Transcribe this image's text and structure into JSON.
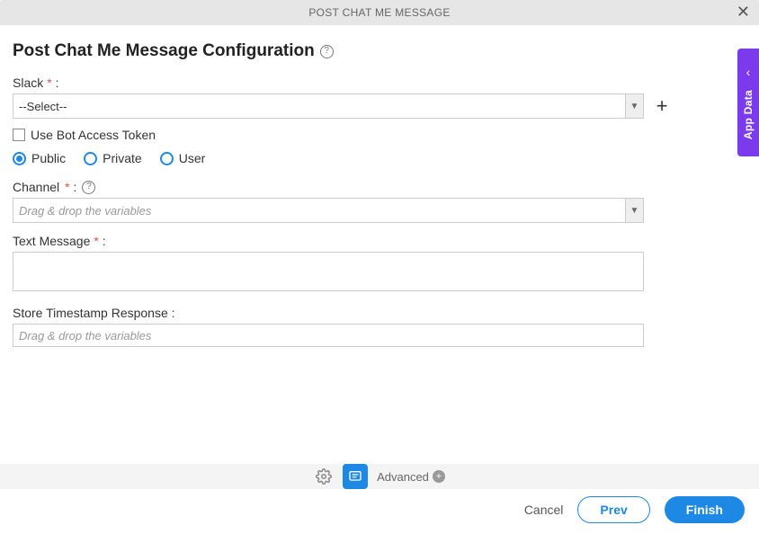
{
  "header": {
    "title": "POST CHAT ME MESSAGE"
  },
  "page": {
    "title": "Post Chat Me Message Configuration"
  },
  "fields": {
    "slack_label": "Slack",
    "slack_select_value": "--Select--",
    "use_bot_label": "Use Bot Access Token",
    "radio_public": "Public",
    "radio_private": "Private",
    "radio_user": "User",
    "channel_label": "Channel",
    "channel_placeholder": "Drag & drop the variables",
    "text_message_label": "Text Message",
    "timestamp_label": "Store Timestamp Response :",
    "timestamp_placeholder": "Drag & drop the variables",
    "required_colon": " * :",
    "colon": " :"
  },
  "toolbar": {
    "advanced_label": "Advanced"
  },
  "footer": {
    "cancel": "Cancel",
    "prev": "Prev",
    "finish": "Finish"
  },
  "side_tab": {
    "label": "App Data"
  }
}
